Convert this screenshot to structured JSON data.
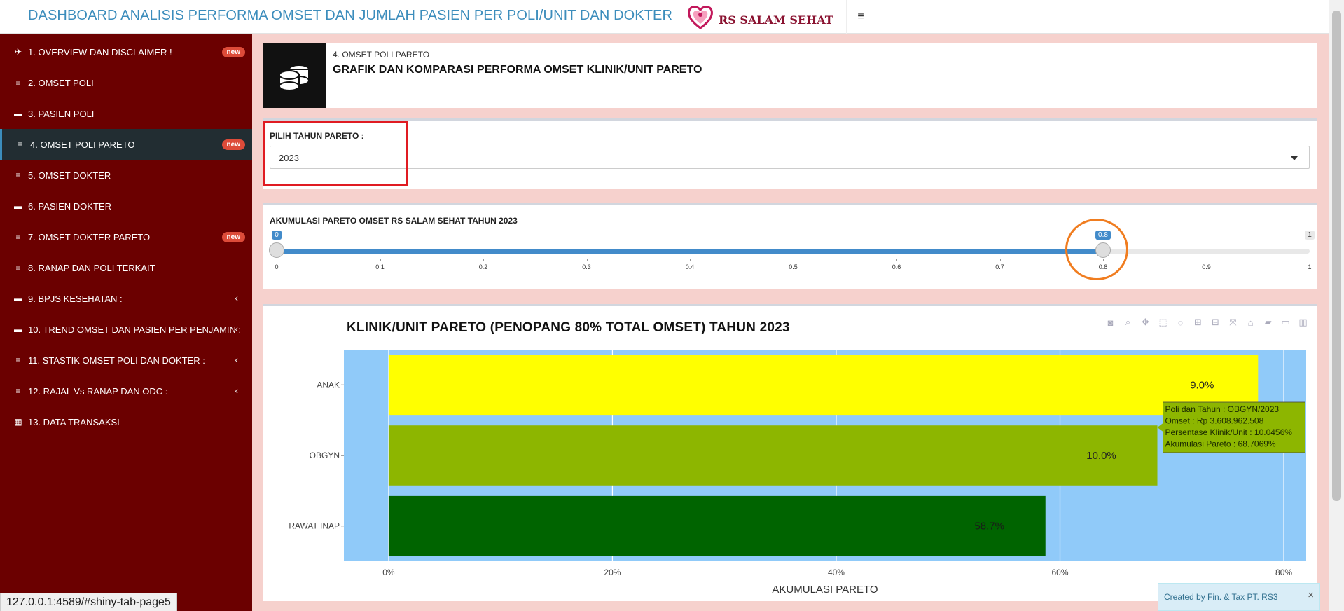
{
  "header": {
    "title": "DASHBOARD ANALISIS PERFORMA OMSET DAN JUMLAH PASIEN PER POLI/UNIT DAN DOKTER",
    "logo_text": "RS SALAM SEHAT",
    "menu_toggle_icon": "hamburger-icon",
    "title_color": "#3c8dbc"
  },
  "sidebar": {
    "items": [
      {
        "label": "1. OVERVIEW DAN DISCLAIMER !",
        "icon": "rocket-icon",
        "badge": "new"
      },
      {
        "label": "2. OMSET POLI",
        "icon": "coins-icon"
      },
      {
        "label": "3. PASIEN POLI",
        "icon": "bed-icon"
      },
      {
        "label": "4. OMSET POLI PARETO",
        "icon": "coins-icon",
        "badge": "new",
        "active": true
      },
      {
        "label": "5. OMSET DOKTER",
        "icon": "coins-icon"
      },
      {
        "label": "6. PASIEN DOKTER",
        "icon": "bed-icon"
      },
      {
        "label": "7. OMSET DOKTER PARETO",
        "icon": "coins-icon",
        "badge": "new"
      },
      {
        "label": "8. RANAP DAN POLI TERKAIT",
        "icon": "coins-icon"
      },
      {
        "label": "9. BPJS KESEHATAN :",
        "icon": "bed-icon",
        "expandable": true
      },
      {
        "label": "10. TREND OMSET DAN PASIEN PER PENJAMIN :",
        "icon": "bed-icon",
        "expandable": true
      },
      {
        "label": "11. STASTIK OMSET POLI DAN DOKTER :",
        "icon": "coins-icon",
        "expandable": true
      },
      {
        "label": "12. RAJAL Vs RANAP DAN ODC :",
        "icon": "coins-icon",
        "expandable": true
      },
      {
        "label": "13. DATA TRANSAKSI",
        "icon": "table-icon"
      }
    ],
    "background": "#6b0000"
  },
  "hero": {
    "subtitle": "4. OMSET POLI PARETO",
    "title": "GRAFIK DAN KOMPARASI PERFORMA OMSET KLINIK/UNIT PARETO",
    "icon": "coins-stack-icon"
  },
  "year_select": {
    "label": "PILIH TAHUN PARETO :",
    "value": "2023"
  },
  "pareto_slider": {
    "label": "AKUMULASI PARETO OMSET RS SALAM SEHAT TAHUN 2023",
    "min_label": "0",
    "value_label": "0.8",
    "max_label": "1",
    "value": 0.8,
    "ticks": [
      "0",
      "0.1",
      "0.2",
      "0.3",
      "0.4",
      "0.5",
      "0.6",
      "0.7",
      "0.8",
      "0.9",
      "1"
    ]
  },
  "chart_data": {
    "type": "bar",
    "orientation": "horizontal",
    "title": "KLINIK/UNIT PARETO (PENOPANG 80% TOTAL OMSET) TAHUN 2023",
    "xlabel": "AKUMULASI PARETO",
    "ylabel": "",
    "categories": [
      "ANAK",
      "OBGYN",
      "RAWAT INAP"
    ],
    "values": [
      77.7,
      68.7,
      58.7
    ],
    "bar_labels": [
      "9.0%",
      "10.0%",
      "58.7%"
    ],
    "colors": [
      "#ffff00",
      "#8db600",
      "#006400"
    ],
    "x_ticks": [
      "0%",
      "20%",
      "40%",
      "60%",
      "80%"
    ],
    "xlim": [
      -4,
      82
    ],
    "plot_background": "#90caf9",
    "grid": true,
    "tooltip": {
      "lines": [
        "Poli dan Tahun : OBGYN/2023",
        "Omset : Rp 3.608.962.508",
        "Persentase Klinik/Unit : 10.0456%",
        "Akumulasi Pareto : 68.7069%"
      ],
      "background": "#8db600"
    }
  },
  "modebar_icons": [
    "camera-icon",
    "zoom-icon",
    "pan-icon",
    "box-select-icon",
    "lasso-icon",
    "zoom-in-icon",
    "zoom-out-icon",
    "autoscale-icon",
    "reset-axes-icon",
    "spike-lines-icon",
    "compare-hover-icon",
    "plotly-logo-icon"
  ],
  "status_bar": {
    "url": "127.0.0.1:4589/#shiny-tab-page5"
  },
  "notification": {
    "text": "Created by Fin. & Tax PT. RS3",
    "close": "×"
  }
}
